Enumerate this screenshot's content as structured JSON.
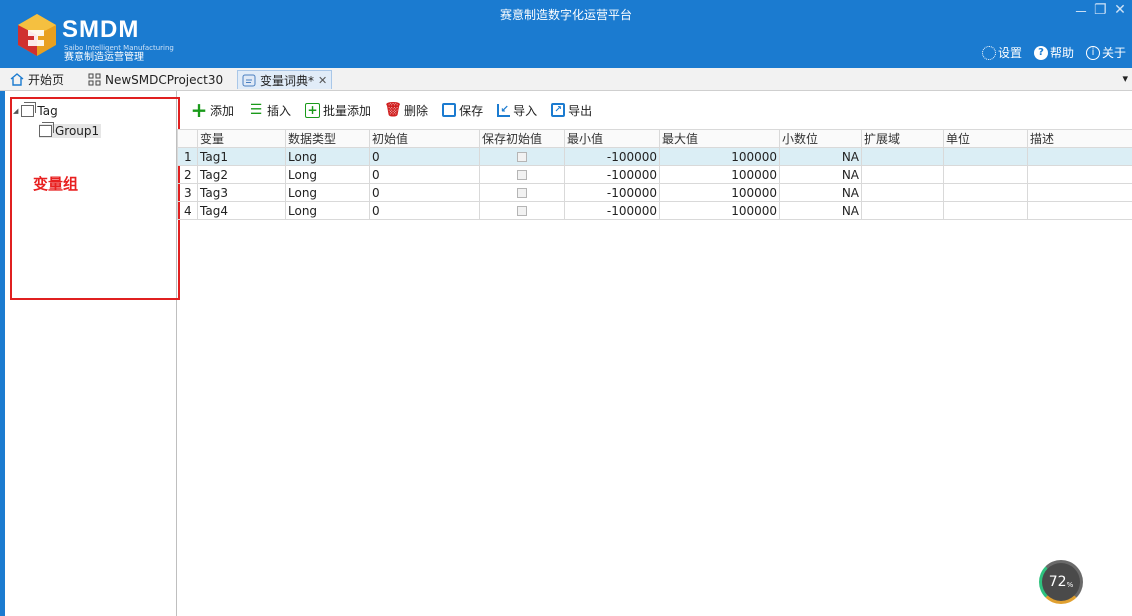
{
  "app": {
    "logo_text": "SMDM",
    "logo_small": "Saibo Intelligent Manufacturing",
    "logo_subtitle": "赛意制造运营管理",
    "title": "赛意制造数字化运营平台",
    "window_controls": {
      "minimize": "－",
      "restore": "❐",
      "close": "✕"
    },
    "links": [
      {
        "label": "设置",
        "icon": "gear-icon"
      },
      {
        "label": "帮助",
        "icon": "help-icon"
      },
      {
        "label": "关于",
        "icon": "info-icon"
      }
    ]
  },
  "tabs": [
    {
      "label": "开始页",
      "icon": "home-icon"
    },
    {
      "label": "NewSMDCProject30",
      "icon": "grid-icon"
    },
    {
      "label": "变量词典*",
      "icon": "dictionary-icon",
      "close": "✕",
      "active": true
    }
  ],
  "tab_menu_glyph": "▾",
  "tree": {
    "root": {
      "toggle": "◢",
      "label": "Tag"
    },
    "child": {
      "label": "Group1"
    },
    "annotation": "变量组"
  },
  "toolbar": {
    "add": "添加",
    "insert": "插入",
    "batch_add": "批量添加",
    "delete": "删除",
    "save": "保存",
    "import": "导入",
    "export": "导出"
  },
  "table": {
    "columns": [
      "变量",
      "数据类型",
      "初始值",
      "保存初始值",
      "最小值",
      "最大值",
      "小数位",
      "扩展域",
      "单位",
      "描述"
    ],
    "rows": [
      {
        "n": "1",
        "name": "Tag1",
        "type": "Long",
        "init": "0",
        "min": "-100000",
        "max": "100000",
        "dec": "NA"
      },
      {
        "n": "2",
        "name": "Tag2",
        "type": "Long",
        "init": "0",
        "min": "-100000",
        "max": "100000",
        "dec": "NA"
      },
      {
        "n": "3",
        "name": "Tag3",
        "type": "Long",
        "init": "0",
        "min": "-100000",
        "max": "100000",
        "dec": "NA"
      },
      {
        "n": "4",
        "name": "Tag4",
        "type": "Long",
        "init": "0",
        "min": "-100000",
        "max": "100000",
        "dec": "NA"
      }
    ]
  },
  "gauge": {
    "value": "72",
    "unit": "%"
  },
  "colors": {
    "brand": "#1b7bd0",
    "annotation": "#e02020",
    "selected_row": "#dbeef5"
  }
}
